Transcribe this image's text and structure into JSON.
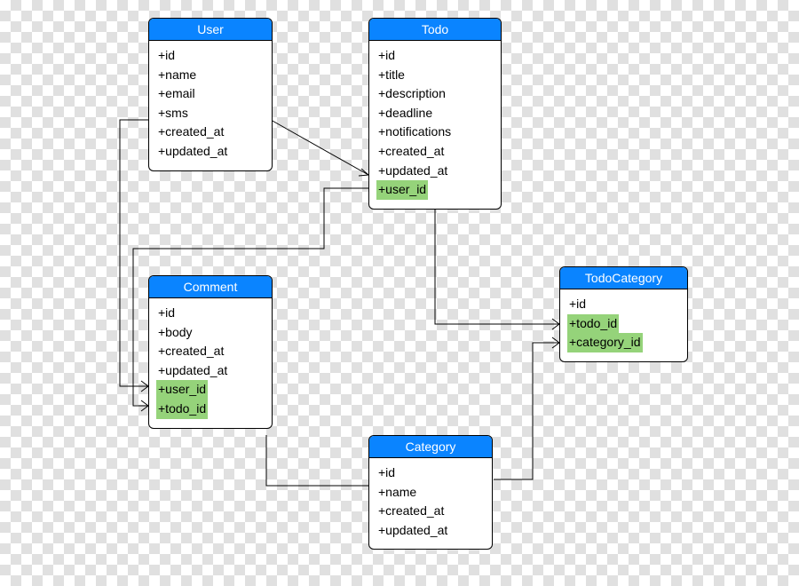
{
  "entities": {
    "user": {
      "name": "User",
      "attrs": [
        {
          "text": "+id",
          "fk": false
        },
        {
          "text": "+name",
          "fk": false
        },
        {
          "text": "+email",
          "fk": false
        },
        {
          "text": "+sms",
          "fk": false
        },
        {
          "text": "+created_at",
          "fk": false
        },
        {
          "text": "+updated_at",
          "fk": false
        }
      ]
    },
    "todo": {
      "name": "Todo",
      "attrs": [
        {
          "text": "+id",
          "fk": false
        },
        {
          "text": "+title",
          "fk": false
        },
        {
          "text": "+description",
          "fk": false
        },
        {
          "text": "+deadline",
          "fk": false
        },
        {
          "text": "+notifications",
          "fk": false
        },
        {
          "text": "+created_at",
          "fk": false
        },
        {
          "text": "+updated_at",
          "fk": false
        },
        {
          "text": "+user_id",
          "fk": true
        }
      ]
    },
    "comment": {
      "name": "Comment",
      "attrs": [
        {
          "text": "+id",
          "fk": false
        },
        {
          "text": "+body",
          "fk": false
        },
        {
          "text": "+created_at",
          "fk": false
        },
        {
          "text": "+updated_at",
          "fk": false
        },
        {
          "text": "+user_id",
          "fk": true
        },
        {
          "text": "+todo_id",
          "fk": true
        }
      ]
    },
    "category": {
      "name": "Category",
      "attrs": [
        {
          "text": "+id",
          "fk": false
        },
        {
          "text": "+name",
          "fk": false
        },
        {
          "text": "+created_at",
          "fk": false
        },
        {
          "text": "+updated_at",
          "fk": false
        }
      ]
    },
    "todocategory": {
      "name": "TodoCategory",
      "attrs": [
        {
          "text": "+id",
          "fk": false
        },
        {
          "text": "+todo_id",
          "fk": true
        },
        {
          "text": "+category_id",
          "fk": true
        }
      ]
    }
  }
}
